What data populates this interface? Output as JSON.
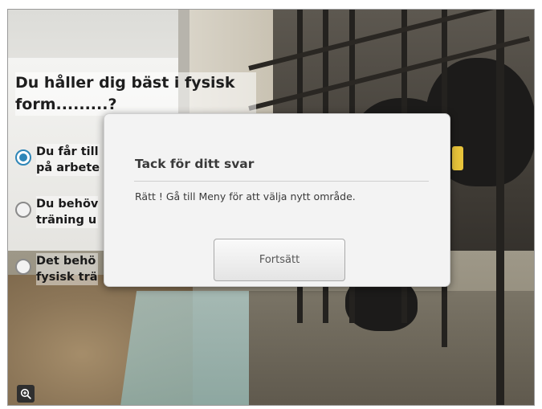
{
  "question": {
    "line1": "Du håller dig bäst i fysisk",
    "line2": "form.........?"
  },
  "options": [
    {
      "label": "Du får till\npå arbete",
      "selected": true
    },
    {
      "label": "Du behöv\nträning u",
      "selected": false
    },
    {
      "label": "Det behö\nfysisk trä",
      "selected": false
    }
  ],
  "dialog": {
    "title": "Tack för ditt svar",
    "message": "Rätt ! Gå till Meny för att välja nytt område.",
    "button_label": "Fortsätt"
  },
  "icons": {
    "zoom": "zoom-in-icon"
  },
  "colors": {
    "accent": "#2e86b8",
    "dialog_bg": "#f3f3f3"
  }
}
